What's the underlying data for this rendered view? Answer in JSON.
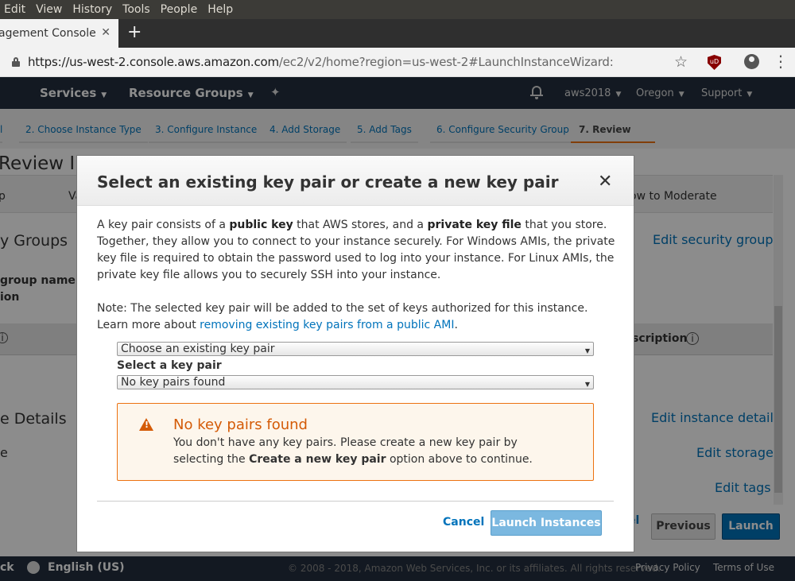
{
  "os_menu": [
    "Edit",
    "View",
    "History",
    "Tools",
    "People",
    "Help"
  ],
  "browser": {
    "tab_title": "agement Console",
    "tab_close": "✕",
    "new_tab": "+",
    "url_domain": "https://us-west-2.console.aws.amazon.com",
    "url_path": "/ec2/v2/home?region=us-west-2#LaunchInstanceWizard:",
    "ublock_label": "uD"
  },
  "awsnav": {
    "services": "Services",
    "resource_groups": "Resource Groups",
    "account": "aws2018",
    "region": "Oregon",
    "support": "Support"
  },
  "steps": [
    "l",
    "2. Choose Instance Type",
    "3. Configure Instance",
    "4. Add Storage",
    "5. Add Tags",
    "6. Configure Security Group",
    "7. Review"
  ],
  "background": {
    "review_title": "Review In",
    "col_p": "p",
    "col_va": "Va",
    "col_moderate": "ow to Moderate",
    "security_groups": "y Groups",
    "edit_security_groups": "Edit security groups",
    "group_name": "group name",
    "ion": "ion",
    "info_i": "i",
    "description": "scription",
    "details": "e Details",
    "edit_instance_details": "Edit instance details",
    "e_label": "e",
    "edit_storage": "Edit storage",
    "edit_tags": "Edit tags",
    "cancel_partial": "el",
    "previous": "Previous",
    "launch": "Launch"
  },
  "footer": {
    "left": "ck",
    "language": "English (US)",
    "copyright": "© 2008 - 2018, Amazon Web Services, Inc. or its affiliates. All rights reserved.",
    "privacy": "Privacy Policy",
    "terms": "Terms of Use"
  },
  "modal": {
    "title": "Select an existing key pair or create a new key pair",
    "close": "✕",
    "body_pre1": "A key pair consists of a ",
    "body_b1": "public key",
    "body_mid1": " that AWS stores, and a ",
    "body_b2": "private key file",
    "body_post": " that you store. Together, they allow you to connect to your instance securely. For Windows AMIs, the private key file is required to obtain the password used to log into your instance. For Linux AMIs, the private key file allows you to securely SSH into your instance.",
    "note_pre": "Note: The selected key pair will be added to the set of keys authorized for this instance. Learn more about ",
    "note_link": "removing existing key pairs from a public AMI",
    "note_post": ".",
    "select_action_value": "Choose an existing key pair",
    "select_label": "Select a key pair",
    "select_keypair_value": "No key pairs found",
    "alert_title": "No key pairs found",
    "alert_msg_pre": "You don't have any key pairs. Please create a new key pair by selecting the ",
    "alert_msg_b": "Create a new key pair",
    "alert_msg_post": " option above to continue.",
    "cancel": "Cancel",
    "launch_instances": "Launch Instances"
  },
  "colors": {
    "aws_nav": "#232f3e",
    "link": "#0073bb",
    "warning": "#d45b07",
    "active_step": "#ec7211"
  }
}
